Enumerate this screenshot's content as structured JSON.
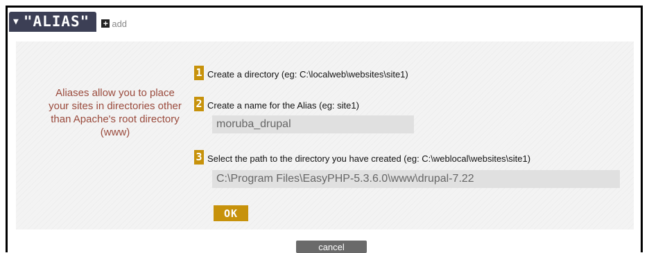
{
  "header": {
    "title": "\"ALIAS\"",
    "add_label": "add"
  },
  "info": {
    "text": "Aliases allow you to place your sites in directories other than Apache's root directory (www)"
  },
  "steps": [
    {
      "number": "1",
      "label": "Create a directory (eg: C:\\localweb\\websites\\site1)"
    },
    {
      "number": "2",
      "label": "Create a name for the Alias (eg: site1)"
    },
    {
      "number": "3",
      "label": "Select the path to the directory you have created (eg: C:\\weblocal\\websites\\site1)"
    }
  ],
  "fields": {
    "alias_name": "moruba_drupal",
    "directory_path": "C:\\Program Files\\EasyPHP-5.3.6.0\\www\\drupal-7.22"
  },
  "buttons": {
    "ok": "OK",
    "cancel": "cancel"
  },
  "colors": {
    "accent": "#c7920b",
    "header_bg": "#3c3f55",
    "info_text": "#9a4a3c"
  },
  "icons": {
    "collapse": "chevron-down-icon",
    "add": "plus-icon"
  }
}
